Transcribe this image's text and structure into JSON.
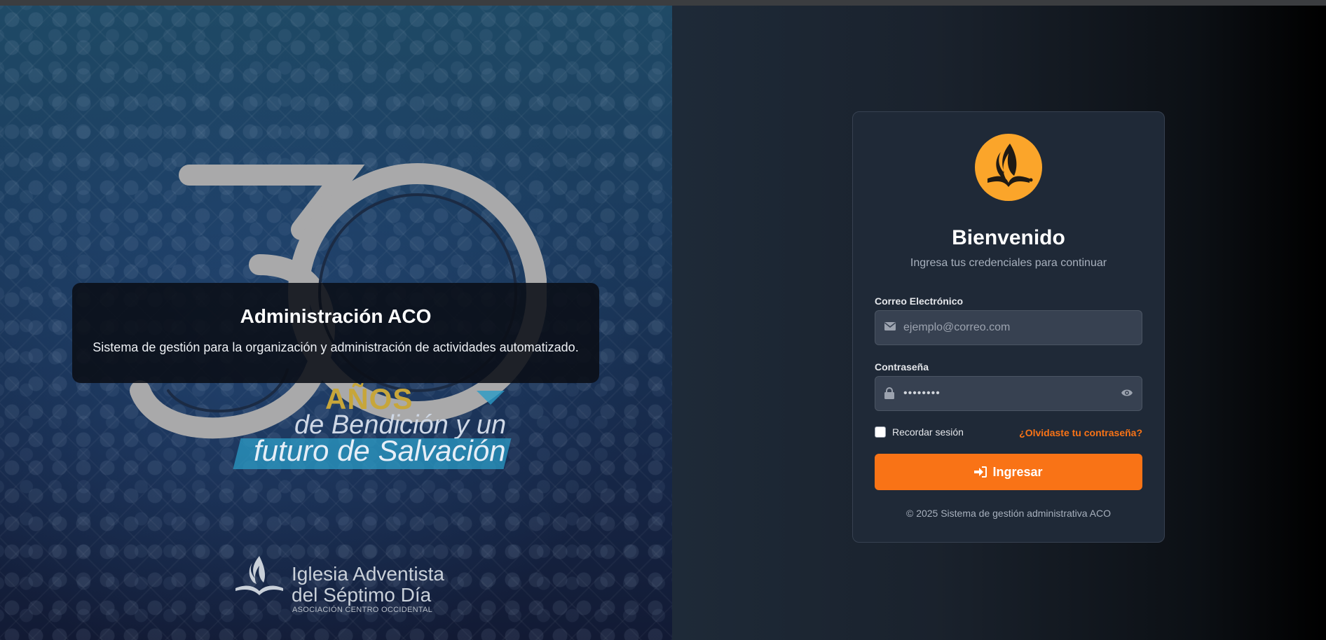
{
  "hero": {
    "title": "Administración ACO",
    "description": "Sistema de gestión para la organización y administración de actividades automatizado.",
    "emblem_number": "30",
    "emblem_anos": "AÑOS",
    "emblem_line1": "de Bendición y un",
    "emblem_line2": "futuro de Salvación",
    "church_name_line1": "Iglesia Adventista",
    "church_name_line2": "del Séptimo Día",
    "church_conference": "ASOCIACIÓN CENTRO OCCIDENTAL"
  },
  "login": {
    "logo_icon": "adventist-flame-icon",
    "title": "Bienvenido",
    "subtitle": "Ingresa tus credenciales para continuar",
    "email_label": "Correo Electrónico",
    "email_placeholder": "ejemplo@correo.com",
    "email_icon": "envelope-icon",
    "password_label": "Contraseña",
    "password_value": "••••••••",
    "password_icon": "lock-icon",
    "toggle_icon": "eye-icon",
    "remember_label": "Recordar sesión",
    "remember_checked": false,
    "forgot_label": "¿Olvidaste tu contraseña?",
    "submit_icon": "sign-in-icon",
    "submit_label": "Ingresar",
    "footer": "© 2025 Sistema de gestión administrativa ACO"
  },
  "colors": {
    "accent": "#f97316",
    "logo": "#fba52a",
    "card": "#1f2937",
    "input": "#374151"
  }
}
